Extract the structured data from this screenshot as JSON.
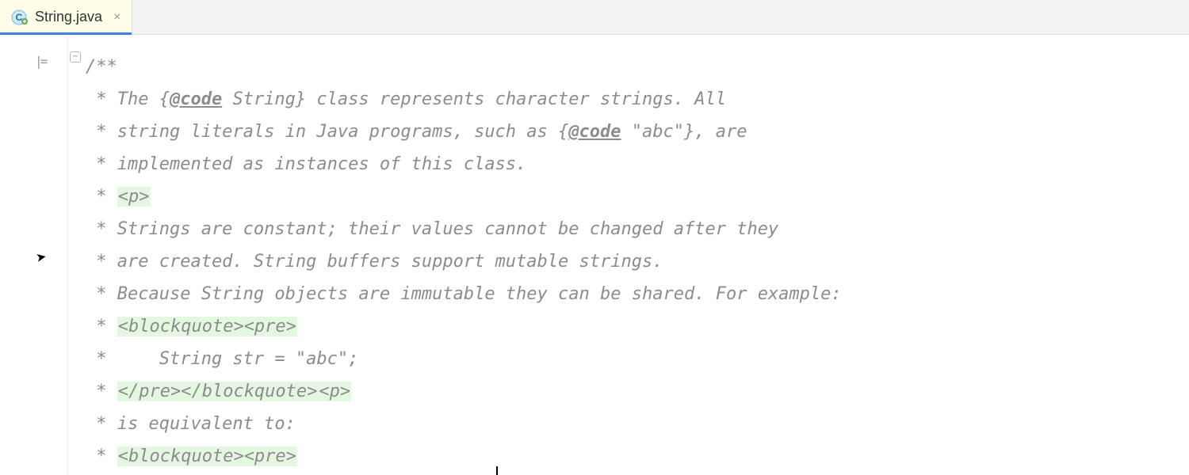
{
  "tab": {
    "filename": "String.java",
    "icon": "class-icon",
    "close_hint": "Close"
  },
  "gutter": {
    "structure_icon": "structure-icon",
    "fold_icon": "fold-handle"
  },
  "code": {
    "lines": [
      {
        "raw": "/**"
      },
      {
        "prefix": " * The {",
        "tag": "@code",
        "after_tag": " String} class represents character strings. All"
      },
      {
        "prefix": " * string literals in Java programs, such as {",
        "tag": "@code",
        "after_tag": " \"abc\"}, are"
      },
      {
        "raw": " * implemented as instances of this class."
      },
      {
        "prefix": " * ",
        "hl": "<p>"
      },
      {
        "raw": " * Strings are constant; their values cannot be changed after they"
      },
      {
        "raw": " * are created. String buffers support mutable strings."
      },
      {
        "raw": " * Because String objects are immutable they can be shared. For example:"
      },
      {
        "prefix": " * ",
        "hl": "<blockquote><pre>"
      },
      {
        "raw": " *     String str = \"abc\";"
      },
      {
        "prefix": " * ",
        "hl": "</pre></blockquote>",
        "after_hl": "<p>"
      },
      {
        "raw": " * is equivalent to:"
      },
      {
        "prefix": " * ",
        "hl": "<blockquote><pre>"
      }
    ]
  }
}
